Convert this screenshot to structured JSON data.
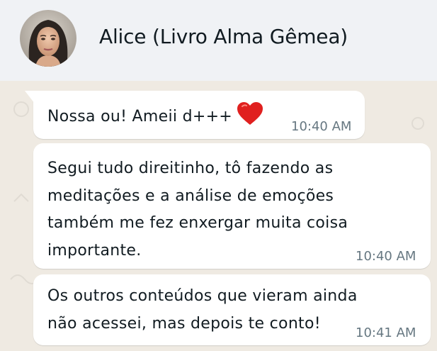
{
  "header": {
    "contact_name": "Alice (Livro Alma Gêmea)",
    "avatar_icon": "profile-photo"
  },
  "messages": [
    {
      "text_lines": [
        "Nossa ou! Ameii d+++"
      ],
      "emoji": "red-heart-icon",
      "time": "10:40 AM"
    },
    {
      "text_lines": [
        "Segui tudo direitinho, tô fazendo as",
        "meditações e a análise de emoções",
        "também me fez enxergar muita coisa",
        "importante."
      ],
      "time": "10:40 AM"
    },
    {
      "text_lines": [
        "Os outros conteúdos que vieram ainda",
        "não acessei, mas depois te conto!"
      ],
      "time": "10:41 AM"
    }
  ],
  "colors": {
    "header_bg": "#f0f2f5",
    "chat_bg": "#efeae2",
    "bubble_bg": "#ffffff",
    "text": "#111b21",
    "time": "#667781",
    "heart": "#e0201f"
  }
}
